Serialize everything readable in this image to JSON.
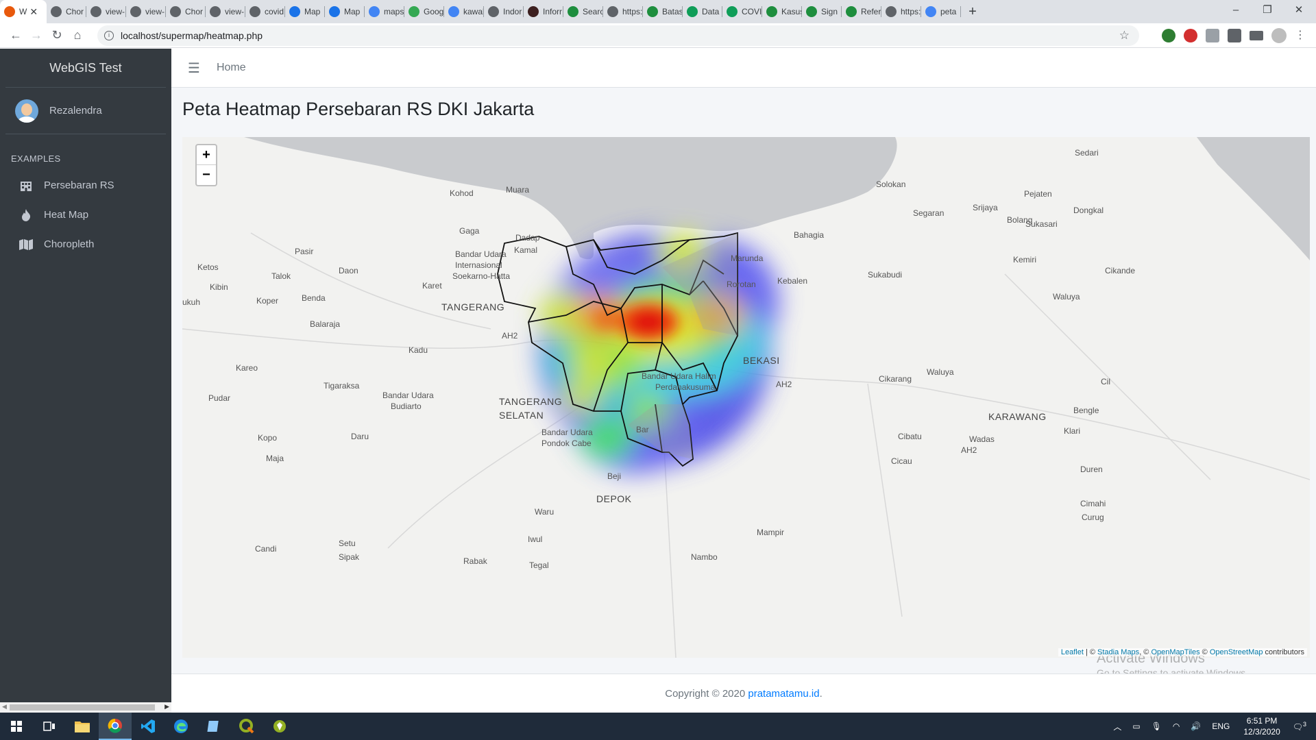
{
  "browser": {
    "tabs": [
      {
        "label": "W",
        "color": "#e8590c",
        "active": true
      },
      {
        "label": "Chor",
        "color": "#5f6368"
      },
      {
        "label": "view-",
        "color": "#5f6368"
      },
      {
        "label": "view-",
        "color": "#5f6368"
      },
      {
        "label": "Chor",
        "color": "#5f6368"
      },
      {
        "label": "view-",
        "color": "#5f6368"
      },
      {
        "label": "covid",
        "color": "#5f6368"
      },
      {
        "label": "Map",
        "color": "#1a73e8"
      },
      {
        "label": "Map",
        "color": "#1a73e8"
      },
      {
        "label": "maps",
        "color": "#4285f4"
      },
      {
        "label": "Goog",
        "color": "#34a853"
      },
      {
        "label": "kawal",
        "color": "#4285f4"
      },
      {
        "label": "Indor",
        "color": "#5f6368"
      },
      {
        "label": "Inforr",
        "color": "#3c1f1f"
      },
      {
        "label": "Searc",
        "color": "#1e8e3e"
      },
      {
        "label": "https:",
        "color": "#5f6368"
      },
      {
        "label": "Batas",
        "color": "#1e8e3e"
      },
      {
        "label": "Data",
        "color": "#0f9d58"
      },
      {
        "label": "COVI",
        "color": "#0f9d58"
      },
      {
        "label": "Kasus",
        "color": "#1e8e3e"
      },
      {
        "label": "Sign",
        "color": "#1e8e3e"
      },
      {
        "label": "Refer",
        "color": "#1e8e3e"
      },
      {
        "label": "https:",
        "color": "#5f6368"
      },
      {
        "label": "peta",
        "color": "#4285f4"
      }
    ],
    "new_tab_label": "+",
    "url": "localhost/supermap/heatmap.php",
    "window_controls": {
      "minimize": "–",
      "restore": "❐",
      "close": "✕"
    }
  },
  "sidebar": {
    "brand": "WebGIS Test",
    "user": "Rezalendra",
    "section_header": "EXAMPLES",
    "items": [
      {
        "label": "Persebaran RS",
        "icon": "building-icon"
      },
      {
        "label": "Heat Map",
        "icon": "fire-icon"
      },
      {
        "label": "Choropleth",
        "icon": "map-icon"
      }
    ]
  },
  "topnav": {
    "menu_icon": "☰",
    "home": "Home"
  },
  "page": {
    "title": "Peta Heatmap Persebaran RS DKI Jakarta"
  },
  "map": {
    "zoom_in": "+",
    "zoom_out": "−",
    "attribution": {
      "leaflet": "Leaflet",
      "sep1": " | © ",
      "stadia": "Stadia Maps",
      "sep2": ", © ",
      "omt": "OpenMapTiles",
      "sep3": " © ",
      "osm": "OpenStreetMap",
      "suffix": " contributors"
    },
    "labels": [
      "Sedari",
      "Kohod",
      "Muara",
      "Solokan",
      "Pejaten",
      "Srijaya",
      "Dongkal",
      "Segaran",
      "Bolang",
      "Sukasari",
      "Gaga",
      "Dadap",
      "Bahagia",
      "Pasir",
      "Bandar Udara",
      "Internasional",
      "Soekarno-Hatta",
      "Kamal",
      "Marunda",
      "Kemiri",
      "Ketos",
      "Daon",
      "Cikande",
      "Talok",
      "Sukabudi",
      "Kebalen",
      "Rorotan",
      "Kibin",
      "Karet",
      "Benda",
      "Koper",
      "Waluya",
      "TANGERANG",
      "ukuh",
      "Balaraja",
      "AH2",
      "Kadu",
      "BEKASI",
      "Bandar Udara Halim",
      "Perdanakusuma",
      "Kareo",
      "Tigaraksa",
      "AH2",
      "Cikarang",
      "Waluya",
      "Cil",
      "Bandar Udara",
      "Budiarto",
      "Pudar",
      "TANGERANG",
      "SELATAN",
      "Bengle",
      "KARAWANG",
      "Klari",
      "Bandar Udara",
      "Pondok Cabe",
      "Kopo",
      "Daru",
      "Cibatu",
      "Wadas",
      "Maja",
      "Cicau",
      "AH2",
      "Duren",
      "Beji",
      "DEPOK",
      "Cimahi",
      "Waru",
      "Curug",
      "Iwul",
      "Mampir",
      "Setu",
      "Candi",
      "Sipak",
      "Nambo",
      "Rabak",
      "Tegal",
      "Bar"
    ]
  },
  "os_watermark": {
    "line1": "Activate Windows",
    "line2": "Go to Settings to activate Windows."
  },
  "footer": {
    "prefix": "Copyright © 2020 ",
    "link": "pratamatamu.id",
    "suffix": "."
  },
  "taskbar": {
    "apps": [
      "windows-start",
      "task-view",
      "file-explorer",
      "chrome",
      "vscode",
      "edge",
      "notepad",
      "qgis",
      "qgis-2"
    ],
    "lang": "ENG",
    "time": "6:51 PM",
    "date": "12/3/2020",
    "notifications": "3"
  }
}
